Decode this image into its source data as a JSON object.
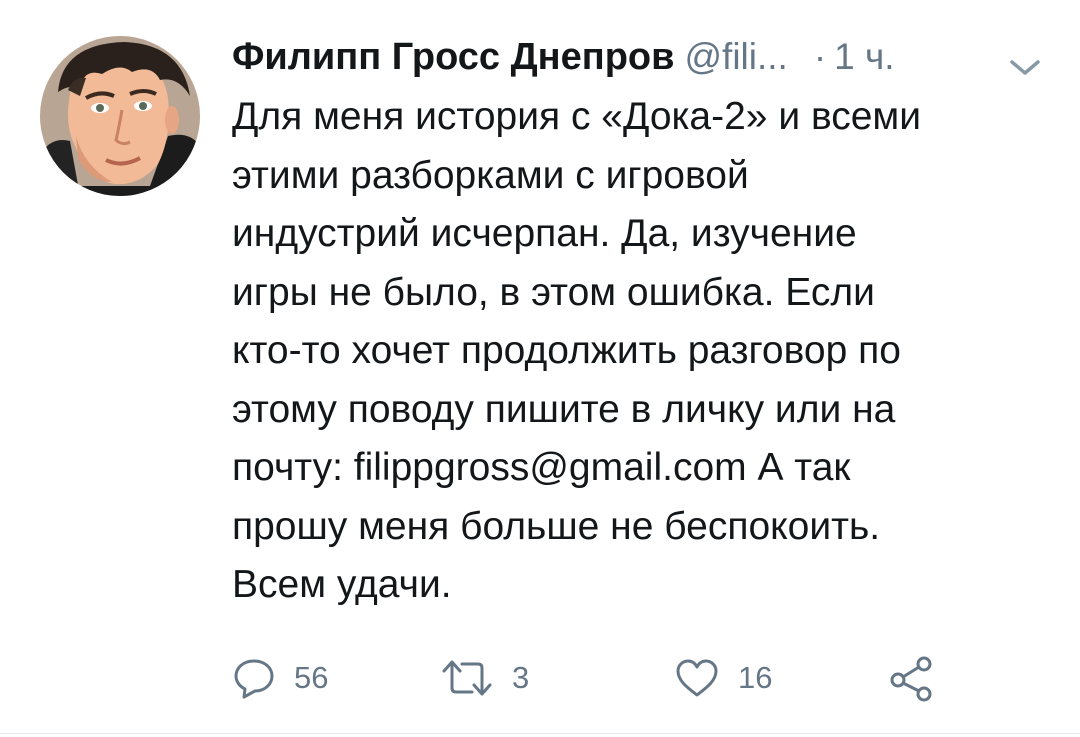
{
  "tweet": {
    "author": {
      "name": "Филипп Гросс Днепров",
      "handle": "@fili...",
      "avatar_icon": "user-avatar-photo"
    },
    "time_separator": "·",
    "time": "1 ч.",
    "menu_icon": "chevron-down-icon",
    "text": "Для меня история с «Дока-2» и всеми\nэтими разборками с игровой\nиндустрий исчерпан. Да, изучение\nигры не было, в этом ошибка. Если\nкто-то хочет продолжить разговор по\nэтому поводу пишите в личку или на\nпочту: filippgross@gmail.com А так\nпрошу меня больше не беспокоить.\nВсем удачи.",
    "actions": {
      "reply": {
        "icon": "reply-icon",
        "count": "56"
      },
      "retweet": {
        "icon": "retweet-icon",
        "count": "3"
      },
      "like": {
        "icon": "heart-icon",
        "count": "16"
      },
      "share": {
        "icon": "share-icon"
      }
    }
  },
  "colors": {
    "text": "#14171a",
    "secondary": "#657786",
    "border": "#e6ecf0",
    "background": "#ffffff"
  }
}
